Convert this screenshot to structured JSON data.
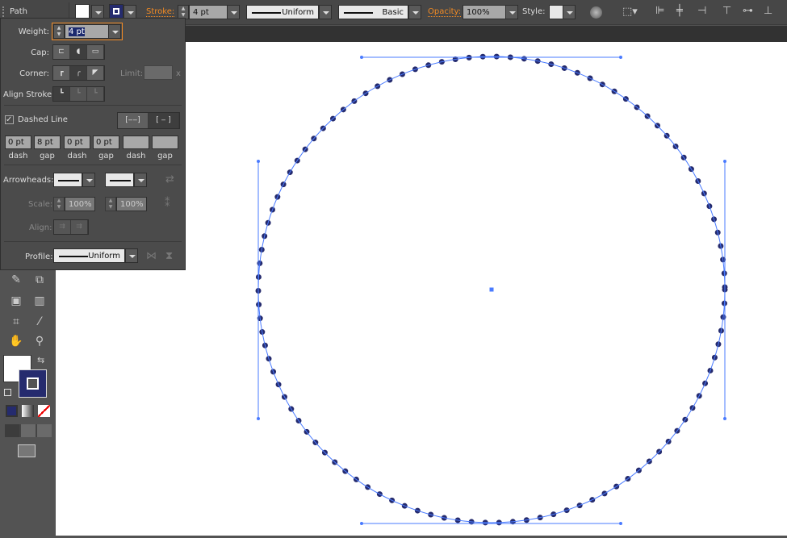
{
  "control_bar": {
    "selection_type": "Path",
    "stroke_label": "Stroke:",
    "stroke_weight": "4 pt",
    "variable_width_profile": "Uniform",
    "brush_definition": "Basic",
    "opacity_label": "Opacity:",
    "opacity": "100%",
    "style_label": "Style:",
    "fill_color": "#ffffff",
    "stroke_color": "#252b6e"
  },
  "stroke_panel": {
    "weight_label": "Weight:",
    "weight": "4 pt",
    "cap_label": "Cap:",
    "corner_label": "Corner:",
    "limit_label": "Limit:",
    "limit_suffix": "x",
    "align_stroke_label": "Align Stroke:",
    "dashed_line_label": "Dashed Line",
    "dashed_line_checked": true,
    "dash_fields": [
      {
        "value": "0 pt",
        "label": "dash"
      },
      {
        "value": "8 pt",
        "label": "gap"
      },
      {
        "value": "0 pt",
        "label": "dash"
      },
      {
        "value": "0 pt",
        "label": "gap"
      },
      {
        "value": "",
        "label": "dash"
      },
      {
        "value": "",
        "label": "gap"
      }
    ],
    "arrowheads_label": "Arrowheads:",
    "scale_label": "Scale:",
    "scale_start": "100%",
    "scale_end": "100%",
    "align_label": "Align:",
    "profile_label": "Profile:",
    "profile": "Uniform"
  },
  "colors": {
    "selection": "#4a7bff",
    "stroke": "#252b6e",
    "accent": "#f08a24"
  }
}
